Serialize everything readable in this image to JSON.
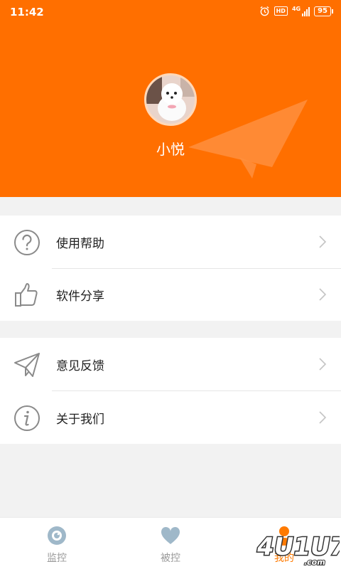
{
  "status_bar": {
    "time": "11:42",
    "network": "4G",
    "hd": "HD",
    "battery": "95"
  },
  "profile": {
    "username": "小悦"
  },
  "menu_groups": [
    {
      "items": [
        {
          "label": "使用帮助",
          "icon": "question-circle-icon"
        },
        {
          "label": "软件分享",
          "icon": "thumbs-up-icon"
        }
      ]
    },
    {
      "items": [
        {
          "label": "意见反馈",
          "icon": "paper-plane-icon"
        },
        {
          "label": "关于我们",
          "icon": "info-circle-icon"
        }
      ]
    }
  ],
  "tabs": [
    {
      "label": "监控",
      "icon": "camera-eye-icon",
      "active": false
    },
    {
      "label": "被控",
      "icon": "heart-icon",
      "active": false
    },
    {
      "label": "我的",
      "icon": "person-icon",
      "active": true
    }
  ],
  "watermark": {
    "text": "4U1U7.com"
  },
  "colors": {
    "primary": "#ff6f00",
    "active_tab": "#ff7a00",
    "inactive_tab": "#999999",
    "icon_gray": "#8a8a8a"
  }
}
